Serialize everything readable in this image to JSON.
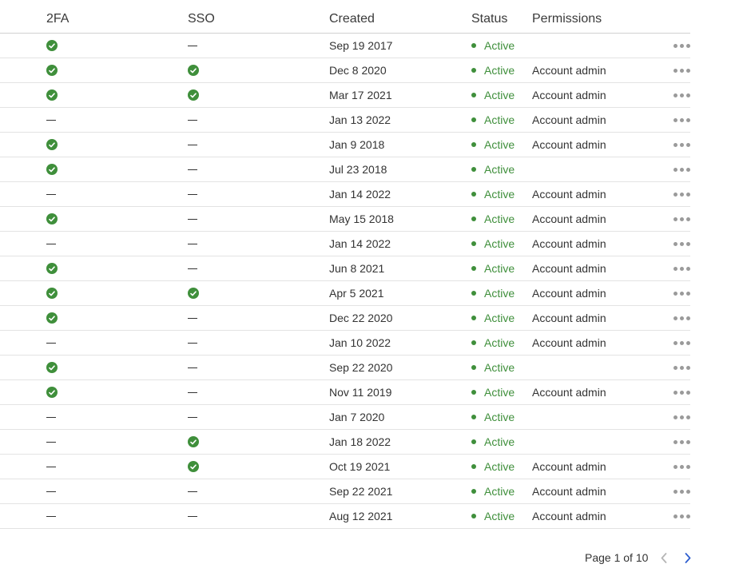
{
  "columns": {
    "twofa": "2FA",
    "sso": "SSO",
    "created": "Created",
    "status": "Status",
    "permissions": "Permissions"
  },
  "icons": {
    "enabled": "check-circle-icon",
    "disabled": "dash",
    "row_menu": "more-horizontal-icon",
    "prev": "chevron-left-icon",
    "next": "chevron-right-icon"
  },
  "colors": {
    "active": "#3f8f3b",
    "pager_next": "#2f5fcf",
    "pager_prev": "#b5b5b5"
  },
  "rows": [
    {
      "twofa": true,
      "sso": false,
      "created": "Sep 19 2017",
      "status": "Active",
      "permissions": ""
    },
    {
      "twofa": true,
      "sso": true,
      "created": "Dec 8 2020",
      "status": "Active",
      "permissions": "Account admin"
    },
    {
      "twofa": true,
      "sso": true,
      "created": "Mar 17 2021",
      "status": "Active",
      "permissions": "Account admin"
    },
    {
      "twofa": false,
      "sso": false,
      "created": "Jan 13 2022",
      "status": "Active",
      "permissions": "Account admin"
    },
    {
      "twofa": true,
      "sso": false,
      "created": "Jan 9 2018",
      "status": "Active",
      "permissions": "Account admin"
    },
    {
      "twofa": true,
      "sso": false,
      "created": "Jul 23 2018",
      "status": "Active",
      "permissions": ""
    },
    {
      "twofa": false,
      "sso": false,
      "created": "Jan 14 2022",
      "status": "Active",
      "permissions": "Account admin"
    },
    {
      "twofa": true,
      "sso": false,
      "created": "May 15 2018",
      "status": "Active",
      "permissions": "Account admin"
    },
    {
      "twofa": false,
      "sso": false,
      "created": "Jan 14 2022",
      "status": "Active",
      "permissions": "Account admin"
    },
    {
      "twofa": true,
      "sso": false,
      "created": "Jun 8 2021",
      "status": "Active",
      "permissions": "Account admin"
    },
    {
      "twofa": true,
      "sso": true,
      "created": "Apr 5 2021",
      "status": "Active",
      "permissions": "Account admin"
    },
    {
      "twofa": true,
      "sso": false,
      "created": "Dec 22 2020",
      "status": "Active",
      "permissions": "Account admin"
    },
    {
      "twofa": false,
      "sso": false,
      "created": "Jan 10 2022",
      "status": "Active",
      "permissions": "Account admin"
    },
    {
      "twofa": true,
      "sso": false,
      "created": "Sep 22 2020",
      "status": "Active",
      "permissions": ""
    },
    {
      "twofa": true,
      "sso": false,
      "created": "Nov 11 2019",
      "status": "Active",
      "permissions": "Account admin"
    },
    {
      "twofa": false,
      "sso": false,
      "created": "Jan 7 2020",
      "status": "Active",
      "permissions": ""
    },
    {
      "twofa": false,
      "sso": true,
      "created": "Jan 18 2022",
      "status": "Active",
      "permissions": ""
    },
    {
      "twofa": false,
      "sso": true,
      "created": "Oct 19 2021",
      "status": "Active",
      "permissions": "Account admin"
    },
    {
      "twofa": false,
      "sso": false,
      "created": "Sep 22 2021",
      "status": "Active",
      "permissions": "Account admin"
    },
    {
      "twofa": false,
      "sso": false,
      "created": "Aug 12 2021",
      "status": "Active",
      "permissions": "Account admin"
    }
  ],
  "pagination": {
    "label": "Page 1 of 10"
  }
}
